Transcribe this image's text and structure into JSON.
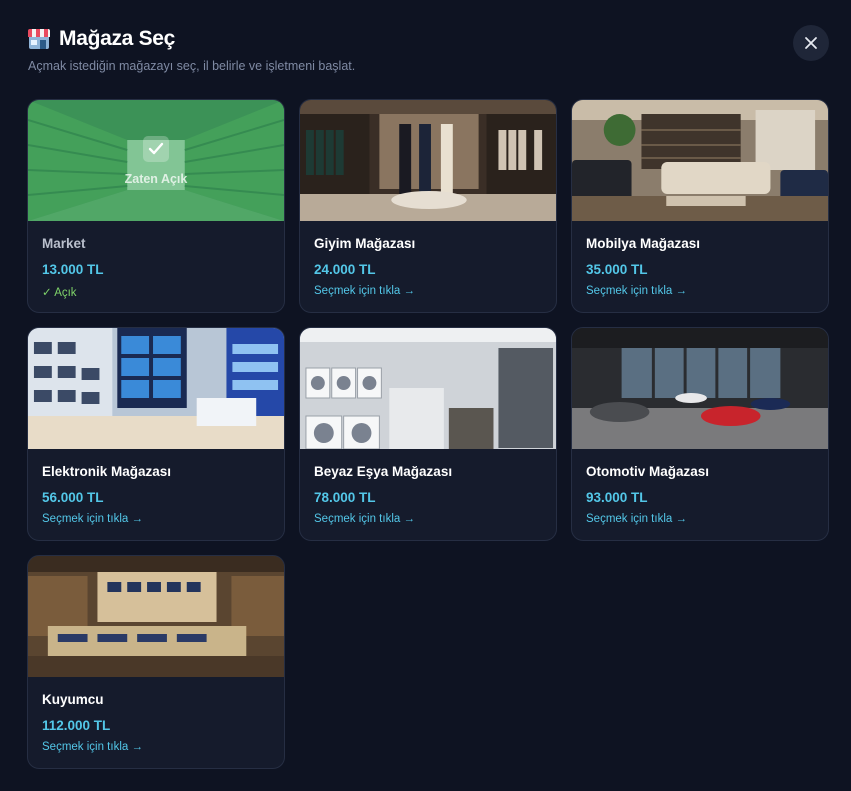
{
  "header": {
    "title": "Mağaza Seç",
    "subtitle": "Açmak istediğin mağazayı seç, il belirle ve işletmeni başlat.",
    "icon": "store-icon"
  },
  "close": {
    "icon": "close-icon"
  },
  "stores": [
    {
      "name": "Market",
      "price": "13.000 TL",
      "status": "✓ Açık",
      "overlay": "Zaten Açık",
      "owned": true
    },
    {
      "name": "Giyim Mağazası",
      "price": "24.000 TL",
      "action": "Seçmek için tıkla →",
      "owned": false
    },
    {
      "name": "Mobilya Mağazası",
      "price": "35.000 TL",
      "action": "Seçmek için tıkla →",
      "owned": false
    },
    {
      "name": "Elektronik Mağazası",
      "price": "56.000 TL",
      "action": "Seçmek için tıkla →",
      "owned": false
    },
    {
      "name": "Beyaz Eşya Mağazası",
      "price": "78.000 TL",
      "action": "Seçmek için tıkla →",
      "owned": false
    },
    {
      "name": "Otomotiv Mağazası",
      "price": "93.000 TL",
      "action": "Seçmek için tıkla →",
      "owned": false
    },
    {
      "name": "Kuyumcu",
      "price": "112.000 TL",
      "action": "Seçmek için tıkla →",
      "owned": false
    }
  ],
  "colors": {
    "accent": "#53c7e8",
    "background": "#0e1322",
    "card": "#151b2c",
    "owned": "#7fd36a"
  }
}
